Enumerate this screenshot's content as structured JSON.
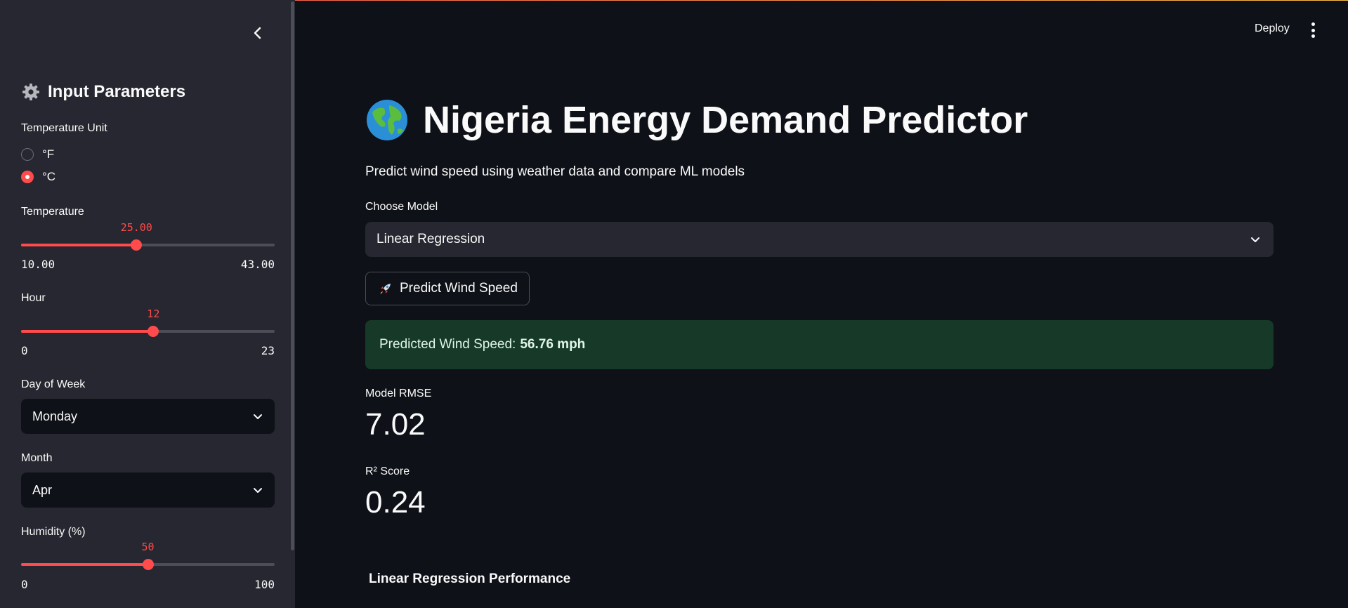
{
  "sidebar": {
    "title": "Input Parameters",
    "temperature_unit": {
      "label": "Temperature Unit",
      "options": [
        "°F",
        "°C"
      ],
      "selected": "°C"
    },
    "temperature": {
      "label": "Temperature",
      "value": "25.00",
      "min": "10.00",
      "max": "43.00",
      "fraction": 0.455
    },
    "hour": {
      "label": "Hour",
      "value": "12",
      "min": "0",
      "max": "23",
      "fraction": 0.522
    },
    "day_of_week": {
      "label": "Day of Week",
      "value": "Monday"
    },
    "month": {
      "label": "Month",
      "value": "Apr"
    },
    "humidity": {
      "label": "Humidity (%)",
      "value": "50",
      "min": "0",
      "max": "100",
      "fraction": 0.5
    }
  },
  "header": {
    "deploy_label": "Deploy"
  },
  "main": {
    "title": "Nigeria Energy Demand Predictor",
    "subtitle": "Predict wind speed using weather data and compare ML models",
    "model_select": {
      "label": "Choose Model",
      "value": "Linear Regression"
    },
    "predict_button": "Predict Wind Speed",
    "prediction": {
      "label": "Predicted Wind Speed:",
      "value": "56.76 mph"
    },
    "metrics": [
      {
        "label": "Model RMSE",
        "value": "7.02"
      },
      {
        "label": "R² Score",
        "value": "0.24"
      }
    ],
    "performance_heading": "Linear Regression Performance"
  },
  "colors": {
    "accent": "#ff4b4b",
    "background": "#0e1117",
    "sidebar": "#262730",
    "success_bg": "#173928"
  }
}
